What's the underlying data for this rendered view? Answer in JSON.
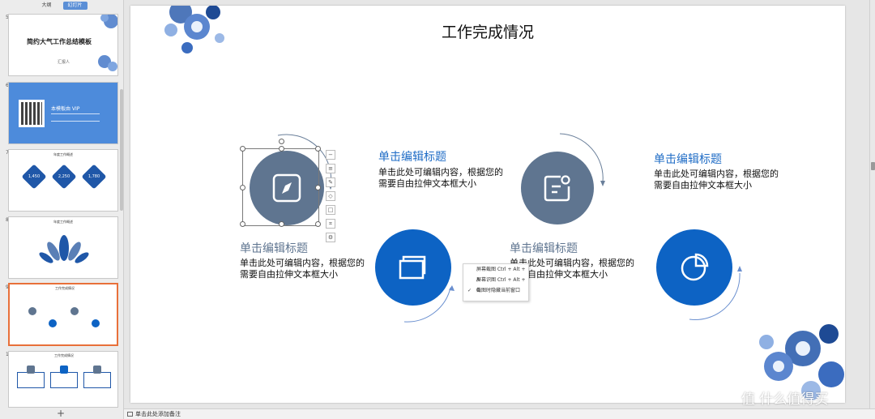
{
  "panel": {
    "tabs": [
      "大纲",
      "幻灯片"
    ],
    "active_tab": "幻灯片",
    "add_label": "+",
    "slides": [
      {
        "num": "5",
        "title": "简约大气工作总结模板",
        "sub": "汇报人"
      },
      {
        "num": "6",
        "title": "本模板由   VIP",
        "sub": ""
      },
      {
        "num": "7",
        "title": "年度工作概述",
        "values": [
          "1,450",
          "2,250",
          "1,780"
        ]
      },
      {
        "num": "8",
        "title": "年度工作概述",
        "sub": ""
      },
      {
        "num": "9",
        "title": "工作完成情况",
        "selected": true
      },
      {
        "num": "10",
        "title": "工作完成情况",
        "sub": ""
      }
    ]
  },
  "slide": {
    "title": "工作完成情况",
    "blocks": [
      {
        "title": "单击编辑标题",
        "body": "单击此处可编辑内容，根据您的需要自由拉伸文本框大小"
      },
      {
        "title": "单击编辑标题",
        "body": "单击此处可编辑内容，根据您的需要自由拉伸文本框大小"
      },
      {
        "title": "单击编辑标题",
        "body": "单击此处可编辑内容，根据您的需要自由拉伸文本框大小"
      },
      {
        "title": "单击编辑标题",
        "body": "单击此处可编辑内容，根据您的需要自由拉伸文本框大小"
      }
    ]
  },
  "context_menu": {
    "items": [
      "屏幕截图 Ctrl + Alt + A",
      "屏幕识图 Ctrl + Alt + O",
      "截图时隐藏当前窗口"
    ],
    "checked_index": 2
  },
  "status_bar": {
    "note": "单击此处添加备注"
  },
  "watermark": "值 什么值得买",
  "colors": {
    "gray_circle": "#5f7590",
    "blue_circle": "#0d63c4",
    "title_gray": "#5f7590",
    "title_blue": "#1f6cc6",
    "selected_thumb": "#e8703a"
  }
}
